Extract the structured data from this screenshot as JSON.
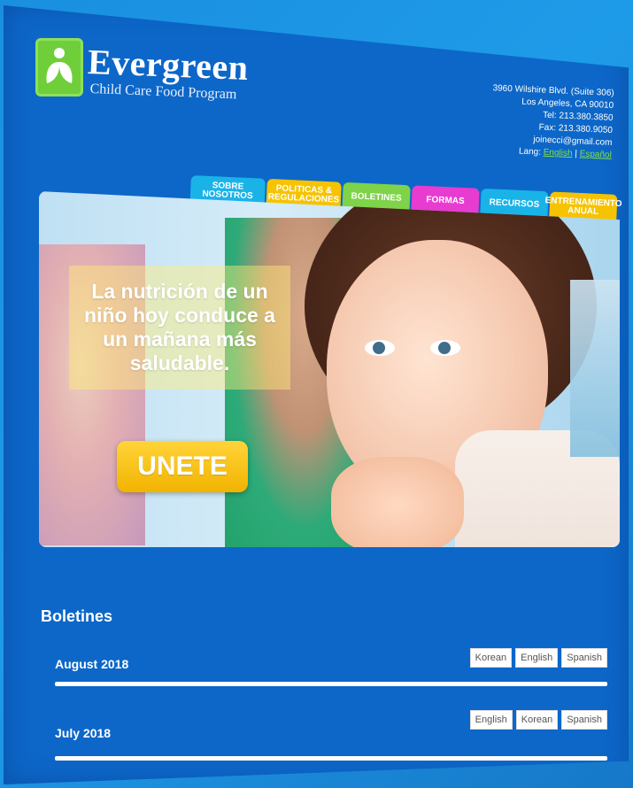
{
  "brand": {
    "name": "Evergreen",
    "tagline": "Child Care Food Program"
  },
  "contact": {
    "address1": "3960 Wilshire Blvd. (Suite 306)",
    "address2": "Los Angeles, CA 90010",
    "tel": "Tel: 213.380.3850",
    "fax": "Fax: 213.380.9050",
    "email": "joinecci@gmail.com",
    "lang_label": "Lang:",
    "lang_english": "English",
    "lang_sep": "|",
    "lang_spanish": "Español"
  },
  "nav": {
    "tabs": [
      {
        "label": "SOBRE NOSOTROS",
        "color": "#1ab3e8"
      },
      {
        "label": "POLITICAS & REGULACIONES",
        "color": "#f6c300"
      },
      {
        "label": "BOLETINES",
        "color": "#7ed348"
      },
      {
        "label": "FORMAS",
        "color": "#e83bd0"
      },
      {
        "label": "RECURSOS",
        "color": "#1ab3e8"
      },
      {
        "label": "ENTRENAMIENTO ANUAL",
        "color": "#f6c300"
      }
    ]
  },
  "hero": {
    "slogan": "La nutrición de un niño hoy conduce a un mañana más saludable.",
    "cta": "UNETE"
  },
  "newsletters": {
    "title": "Boletines",
    "items": [
      {
        "title": "August 2018",
        "buttons": [
          "Korean",
          "English",
          "Spanish"
        ]
      },
      {
        "title": "July 2018",
        "buttons": [
          "English",
          "Korean",
          "Spanish"
        ]
      }
    ]
  },
  "colors": {
    "background": "#0d67c8",
    "accent_green": "#7ed348",
    "accent_yellow": "#f6c300"
  }
}
